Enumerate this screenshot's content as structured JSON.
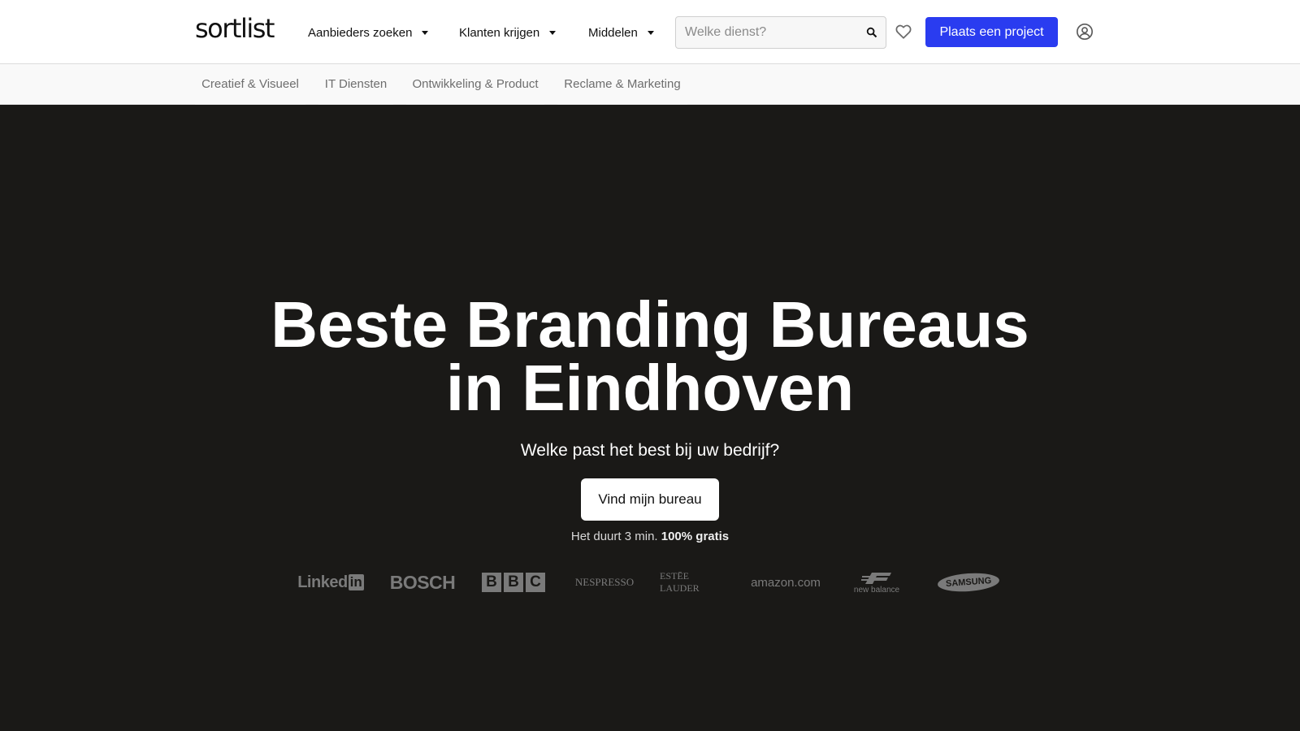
{
  "header": {
    "logo": "sortlist",
    "nav": [
      {
        "label": "Aanbieders zoeken"
      },
      {
        "label": "Klanten krijgen"
      },
      {
        "label": "Middelen"
      }
    ],
    "search": {
      "placeholder": "Welke dienst?",
      "value": ""
    },
    "cta_label": "Plaats een project",
    "accent": "#2a3cf0"
  },
  "categories": [
    "Creatief & Visueel",
    "IT Diensten",
    "Ontwikkeling & Product",
    "Reclame & Marketing"
  ],
  "hero": {
    "title_line1": "Beste Branding Bureaus",
    "title_line2": "in Eindhoven",
    "subtitle": "Welke past het best bij uw bedrijf?",
    "button_label": "Vind mijn bureau",
    "note_text": "Het duurt 3 min.",
    "note_bold": "100% gratis",
    "background": "#1a1917"
  },
  "client_logos": [
    "Linked",
    "in",
    "BOSCH",
    "B",
    "B",
    "C",
    "NESPRESSO",
    "ESTĒE LAUDER",
    "amazon.com",
    "new balance",
    "SAMSUNG"
  ]
}
